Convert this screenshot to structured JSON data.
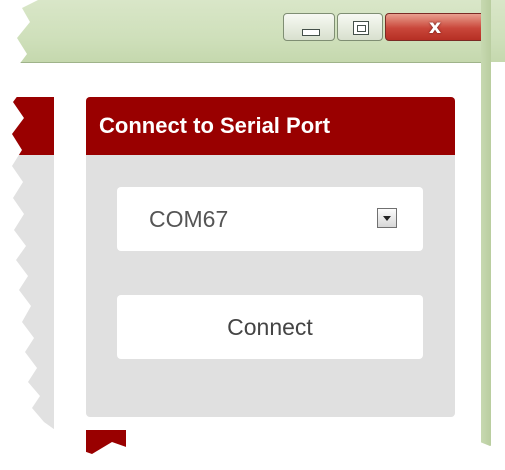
{
  "window": {
    "close_glyph": "x",
    "minimize_icon": "minimize-icon",
    "maximize_icon": "maximize-icon"
  },
  "serial_panel": {
    "title": "Connect to Serial Port",
    "port_select": {
      "selected": "COM67",
      "arrow_icon": "chevron-down-icon"
    },
    "connect_label": "Connect"
  },
  "colors": {
    "header_red": "#990000",
    "panel_gray": "#e0e0e0",
    "titlebar_green": "#cfe0bb"
  }
}
